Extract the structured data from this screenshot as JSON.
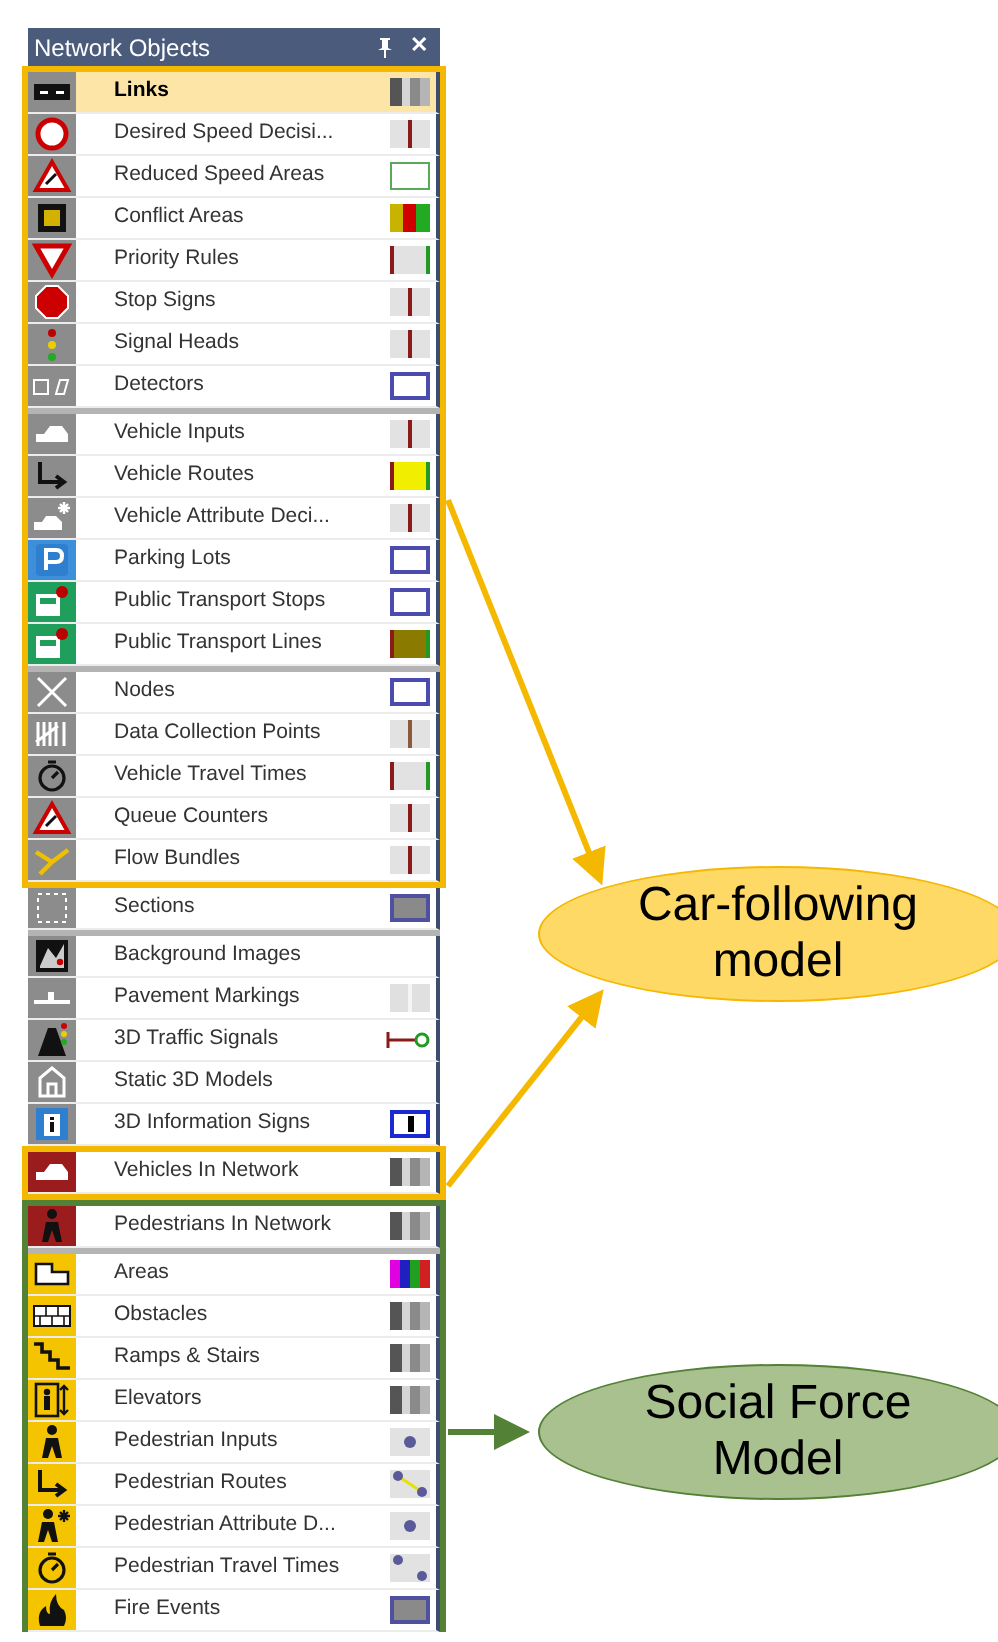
{
  "panel": {
    "title": "Network Objects",
    "close": "✕",
    "groups": [
      {
        "items": [
          {
            "label": "Links",
            "selected": true,
            "kind": "stripes",
            "color": "#8c8c8c"
          },
          {
            "label": "Desired Speed Decisi...",
            "selected": false,
            "kind": "red-mark",
            "color": "#8c8c8c"
          },
          {
            "label": "Reduced Speed Areas",
            "selected": false,
            "kind": "green-outline",
            "color": "#8c8c8c"
          },
          {
            "label": "Conflict Areas",
            "selected": false,
            "kind": "conflict",
            "color": "#8c8c8c"
          },
          {
            "label": "Priority Rules",
            "selected": false,
            "kind": "priority",
            "color": "#8c8c8c"
          },
          {
            "label": "Stop Signs",
            "selected": false,
            "kind": "red-mark",
            "color": "#8c8c8c"
          },
          {
            "label": "Signal Heads",
            "selected": false,
            "kind": "red-mark",
            "color": "#8c8c8c"
          },
          {
            "label": "Detectors",
            "selected": false,
            "kind": "blue-outline",
            "color": "#8c8c8c"
          }
        ]
      },
      {
        "items": [
          {
            "label": "Vehicle Inputs",
            "selected": false,
            "kind": "red-mark",
            "color": "#8c8c8c"
          },
          {
            "label": "Vehicle Routes",
            "selected": false,
            "kind": "route",
            "color": "#8c8c8c"
          },
          {
            "label": "Vehicle Attribute Deci...",
            "selected": false,
            "kind": "red-mark",
            "color": "#8c8c8c"
          },
          {
            "label": "Parking Lots",
            "selected": false,
            "kind": "blue-outline",
            "color": "#3d8fd9"
          },
          {
            "label": "Public Transport Stops",
            "selected": false,
            "kind": "blue-outline",
            "color": "#1f9e5c"
          },
          {
            "label": "Public Transport Lines",
            "selected": false,
            "kind": "pt-line",
            "color": "#1f9e5c"
          }
        ]
      },
      {
        "items": [
          {
            "label": "Nodes",
            "selected": false,
            "kind": "blue-outline",
            "color": "#8c8c8c"
          },
          {
            "label": "Data Collection Points",
            "selected": false,
            "kind": "brown-mark",
            "color": "#8c8c8c"
          },
          {
            "label": "Vehicle Travel Times",
            "selected": false,
            "kind": "priority",
            "color": "#8c8c8c"
          },
          {
            "label": "Queue Counters",
            "selected": false,
            "kind": "red-mark",
            "color": "#8c8c8c"
          },
          {
            "label": "Flow Bundles",
            "selected": false,
            "kind": "red-mark",
            "color": "#8c8c8c"
          },
          {
            "label": "Sections",
            "selected": false,
            "kind": "gray-fill",
            "color": "#8c8c8c"
          }
        ]
      },
      {
        "items": [
          {
            "label": "Background Images",
            "selected": false,
            "color": "#8c8c8c"
          },
          {
            "label": "Pavement Markings",
            "selected": false,
            "kind": "blank-pair",
            "color": "#8c8c8c"
          },
          {
            "label": "3D Traffic Signals",
            "selected": false,
            "kind": "signal-line",
            "color": "#8c8c8c"
          },
          {
            "label": "Static 3D Models",
            "selected": false,
            "color": "#8c8c8c"
          },
          {
            "label": "3D Information Signs",
            "selected": false,
            "kind": "info-tile",
            "color": "#8c8c8c"
          },
          {
            "label": "Vehicles In Network",
            "selected": false,
            "kind": "stripes",
            "color": "#9b1c1c"
          },
          {
            "label": "Pedestrians In Network",
            "selected": false,
            "kind": "stripes",
            "color": "#9b1c1c"
          }
        ]
      },
      {
        "items": [
          {
            "label": "Areas",
            "selected": false,
            "kind": "rainbow",
            "color": "#f5c400"
          },
          {
            "label": "Obstacles",
            "selected": false,
            "kind": "stripes",
            "color": "#f5c400"
          },
          {
            "label": "Ramps & Stairs",
            "selected": false,
            "kind": "stripes",
            "color": "#f5c400"
          },
          {
            "label": "Elevators",
            "selected": false,
            "kind": "stripes",
            "color": "#f5c400"
          },
          {
            "label": "Pedestrian Inputs",
            "selected": false,
            "kind": "dot",
            "color": "#f5c400"
          },
          {
            "label": "Pedestrian Routes",
            "selected": false,
            "kind": "dot-link",
            "color": "#f5c400"
          },
          {
            "label": "Pedestrian Attribute D...",
            "selected": false,
            "kind": "dot",
            "color": "#f5c400"
          },
          {
            "label": "Pedestrian Travel Times",
            "selected": false,
            "kind": "dot-pair",
            "color": "#f5c400"
          },
          {
            "label": "Fire Events",
            "selected": false,
            "kind": "gray-fill",
            "color": "#f5c400"
          }
        ]
      }
    ]
  },
  "models": [
    {
      "label": "Car-following model",
      "color": "#ffd966"
    },
    {
      "label": "Social Force Model",
      "color": "#a9c08f"
    }
  ]
}
